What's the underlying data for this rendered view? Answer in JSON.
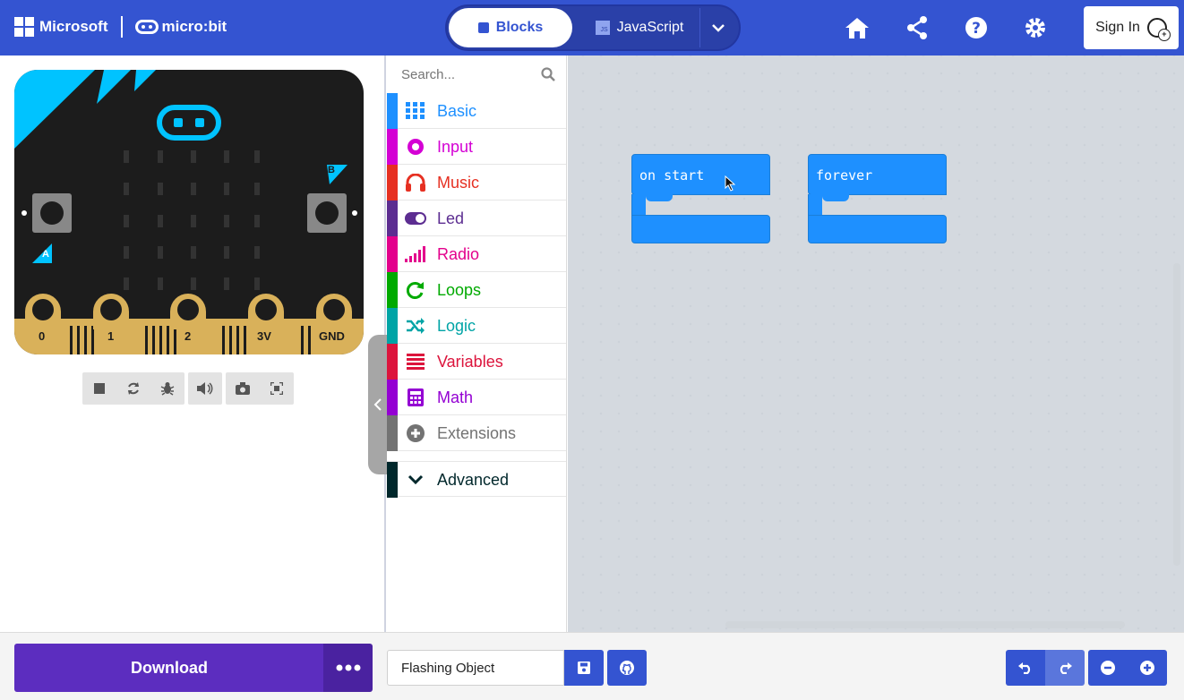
{
  "header": {
    "ms_brand": "Microsoft",
    "mb_brand": "micro:bit",
    "tab_blocks": "Blocks",
    "tab_javascript": "JavaScript",
    "js_badge": "JS",
    "sign_in": "Sign In",
    "icons": [
      "home-icon",
      "share-icon",
      "help-icon",
      "settings-icon"
    ]
  },
  "simulator": {
    "pins": [
      "0",
      "1",
      "2",
      "3V",
      "GND"
    ],
    "button_a": "A",
    "button_b": "B",
    "controls": [
      "stop-icon",
      "restart-icon",
      "debug-icon",
      "mute-icon",
      "screenshot-icon",
      "fullscreen-icon"
    ]
  },
  "toolbox": {
    "search_placeholder": "Search...",
    "categories": [
      {
        "label": "Basic",
        "color": "#1e90ff"
      },
      {
        "label": "Input",
        "color": "#d400d4"
      },
      {
        "label": "Music",
        "color": "#e63022"
      },
      {
        "label": "Led",
        "color": "#5c2d91"
      },
      {
        "label": "Radio",
        "color": "#e3008c"
      },
      {
        "label": "Loops",
        "color": "#00aa00"
      },
      {
        "label": "Logic",
        "color": "#00a4a6"
      },
      {
        "label": "Variables",
        "color": "#dc143c"
      },
      {
        "label": "Math",
        "color": "#9400d3"
      },
      {
        "label": "Extensions",
        "color": "#737373"
      },
      {
        "label": "Advanced",
        "color": "#00272b"
      }
    ]
  },
  "workspace": {
    "block_color": "#1e90ff",
    "blocks": [
      {
        "label": "on start"
      },
      {
        "label": "forever"
      }
    ]
  },
  "footer": {
    "download": "Download",
    "project_name": "Flashing Object",
    "accent": "#3454d1",
    "download_color": "#5c2dbf"
  }
}
